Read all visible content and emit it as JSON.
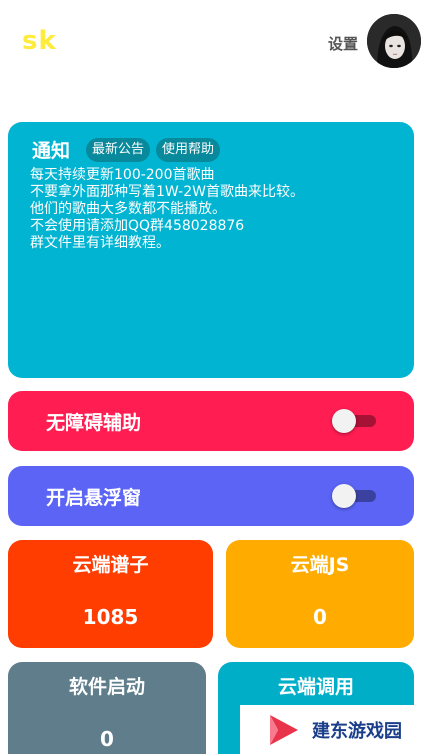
{
  "app": {
    "logo": "sk"
  },
  "header": {
    "settings_label": "设置"
  },
  "notice": {
    "title": "通知",
    "chips": [
      "最新公告",
      "使用帮助"
    ],
    "lines": [
      "每天持续更新100-200首歌曲",
      "不要拿外面那种写着1W-2W首歌曲来比较。",
      "他们的歌曲大多数都不能播放。",
      "不会使用请添加QQ群458028876",
      "群文件里有详细教程。"
    ]
  },
  "toggles": [
    {
      "label": "无障碍辅助",
      "on": false,
      "color": "#ff1d52"
    },
    {
      "label": "开启悬浮窗",
      "on": false,
      "color": "#5b64f5"
    }
  ],
  "stats": [
    {
      "title": "云端谱子",
      "value": "1085",
      "color": "#ff3d00"
    },
    {
      "title": "云端JS",
      "value": "0",
      "color": "#ffab00"
    },
    {
      "title": "软件启动",
      "value": "0",
      "color": "#607d8b"
    },
    {
      "title": "云端调用",
      "value": "",
      "color": "#00aec8"
    }
  ],
  "watermark": {
    "text": "建东游戏园"
  }
}
